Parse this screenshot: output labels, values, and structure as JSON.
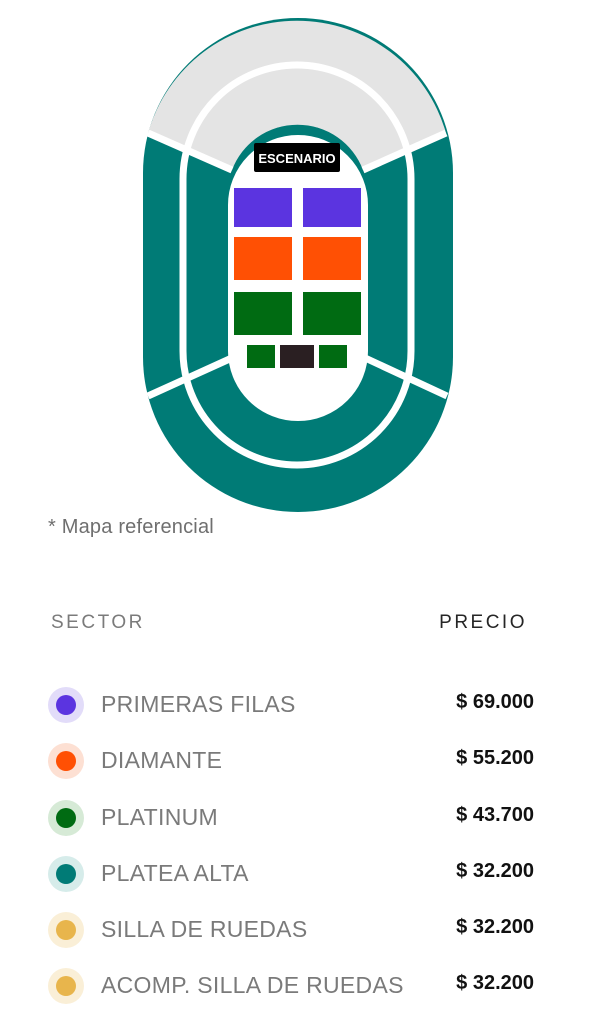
{
  "map": {
    "stage_label": "ESCENARIO",
    "note": "* Mapa referencial",
    "colors": {
      "upper_ring": "#e4e4e4",
      "platea_alta": "#007b76",
      "primeras_filas": "#5b34e0",
      "diamante": "#ff5004",
      "platinum": "#006b12",
      "silla_de_ruedas": "#2a1f22",
      "stage": "#000000",
      "outline": "#ffffff"
    }
  },
  "table": {
    "header_sector": "SECTOR",
    "header_price": "PRECIO",
    "rows": [
      {
        "label": "PRIMERAS FILAS",
        "price": "$ 69.000",
        "color": "#5b34e0",
        "halo": "#e2dcf9"
      },
      {
        "label": "DIAMANTE",
        "price": "$ 55.200",
        "color": "#ff5004",
        "halo": "#fde0d3"
      },
      {
        "label": "PLATINUM",
        "price": "$ 43.700",
        "color": "#006b12",
        "halo": "#d6ead6"
      },
      {
        "label": "PLATEA ALTA",
        "price": "$ 32.200",
        "color": "#007b76",
        "halo": "#d6ecea"
      },
      {
        "label": "SILLA DE RUEDAS",
        "price": "$ 32.200",
        "color": "#e8b54c",
        "halo": "#faefd7"
      },
      {
        "label": "ACOMP. SILLA DE RUEDAS",
        "price": "$ 32.200",
        "color": "#e8b54c",
        "halo": "#faefd7"
      }
    ]
  }
}
